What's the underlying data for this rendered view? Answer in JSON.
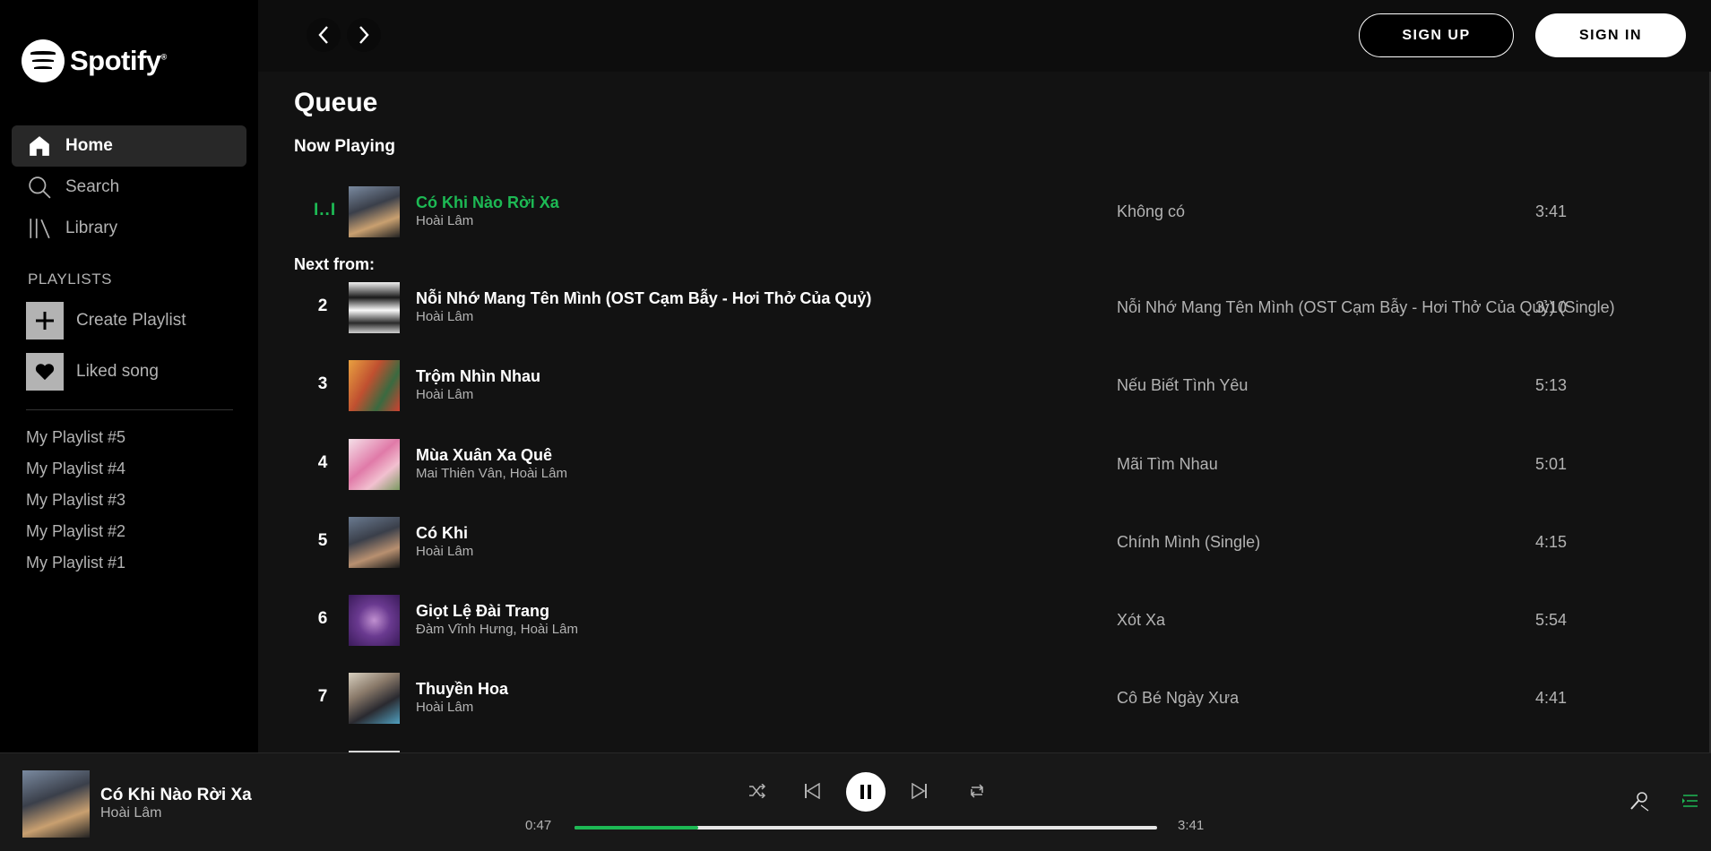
{
  "app": {
    "logo_text": "Spotify",
    "logo_mark": "®"
  },
  "sidebar": {
    "nav": [
      {
        "label": "Home",
        "icon": "home-icon",
        "active": true
      },
      {
        "label": "Search",
        "icon": "search-icon",
        "active": false
      },
      {
        "label": "Library",
        "icon": "library-icon",
        "active": false
      }
    ],
    "playlists_heading": "PLAYLISTS",
    "create_playlist": "Create Playlist",
    "liked_song": "Liked song",
    "playlists": [
      "My Playlist #5",
      "My Playlist #4",
      "My Playlist #3",
      "My Playlist #2",
      "My Playlist #1"
    ]
  },
  "topbar": {
    "sign_up": "SIGN UP",
    "sign_in": "SIGN IN"
  },
  "queue": {
    "title": "Queue",
    "now_playing_label": "Now Playing",
    "next_from_label": "Next from:",
    "now_playing": {
      "indicator": "I..I",
      "title": "Có Khi Nào Rời Xa",
      "artist": "Hoài Lâm",
      "album": "Không có",
      "duration": "3:41"
    },
    "next": [
      {
        "num": "2",
        "title": "Nỗi Nhớ Mang Tên Mình (OST Cạm Bẫy - Hơi Thở Của Quỷ)",
        "artist": "Hoài Lâm",
        "album": "Nỗi Nhớ Mang Tên Mình (OST Cạm Bẫy - Hơi Thở Của Quỷ) (Single)",
        "duration": "3:10"
      },
      {
        "num": "3",
        "title": "Trộm Nhìn Nhau",
        "artist": "Hoài Lâm",
        "album": "Nếu Biết Tình Yêu",
        "duration": "5:13"
      },
      {
        "num": "4",
        "title": "Mùa Xuân Xa Quê",
        "artist": "Mai Thiên Vân, Hoài Lâm",
        "album": "Mãi Tìm Nhau",
        "duration": "5:01"
      },
      {
        "num": "5",
        "title": "Có Khi",
        "artist": "Hoài Lâm",
        "album": "Chính Mình (Single)",
        "duration": "4:15"
      },
      {
        "num": "6",
        "title": "Giọt Lệ Đài Trang",
        "artist": "Đàm Vĩnh Hưng, Hoài Lâm",
        "album": "Xót Xa",
        "duration": "5:54"
      },
      {
        "num": "7",
        "title": "Thuyền Hoa",
        "artist": "Hoài Lâm",
        "album": "Cô Bé Ngày Xưa",
        "duration": "4:41"
      }
    ]
  },
  "player": {
    "title": "Có Khi Nào Rời Xa",
    "artist": "Hoài Lâm",
    "elapsed": "0:47",
    "total": "3:41",
    "progress_fraction": 0.212
  },
  "colors": {
    "accent": "#1db954",
    "sidebar_bg": "#000000",
    "main_bg": "#121212",
    "player_bg": "#181818"
  }
}
